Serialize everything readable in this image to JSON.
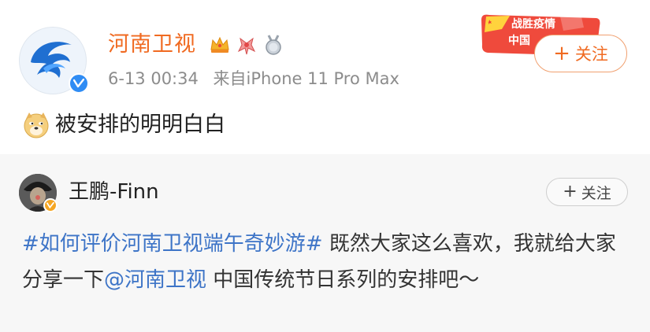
{
  "post": {
    "username": "河南卫视",
    "time": "6-13 00:34",
    "source": "来自iPhone 11 Pro Max",
    "content": "被安排的明明白白",
    "follow_label": "关注",
    "follow_plus": "+",
    "campaign_line1": "战胜疫情",
    "campaign_line2": "中国",
    "badges": [
      "crown-icon",
      "ribbon-icon",
      "medal-icon"
    ]
  },
  "repost": {
    "username": "王鹏-Finn",
    "follow_label": "关注",
    "follow_plus": "+",
    "hashtag": "#如何评价河南卫视端午奇妙游#",
    "text1": " 既然大家这么喜欢，我就给大家分享一下",
    "mention": "@河南卫视",
    "text2": " 中国传统节日系列的安排吧～"
  },
  "colors": {
    "username": "#f06a21",
    "link": "#3d74c7",
    "verified": "#2f8cf4"
  }
}
